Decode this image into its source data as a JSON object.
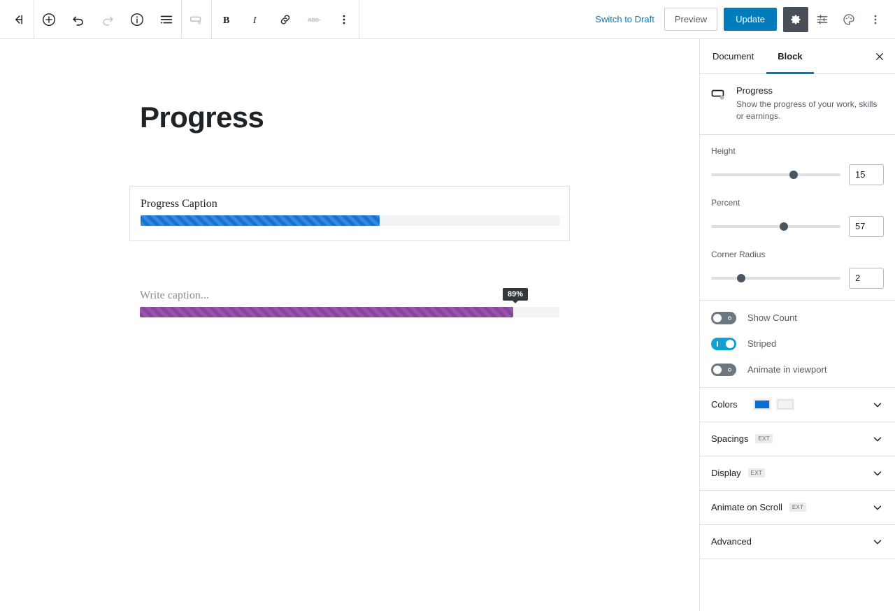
{
  "toolbar": {
    "left_icons": [
      {
        "name": "back-to-dashboard-icon",
        "label": "Back"
      },
      {
        "name": "add-block-icon",
        "label": "Add block"
      },
      {
        "name": "undo-icon",
        "label": "Undo"
      },
      {
        "name": "redo-icon",
        "label": "Redo"
      },
      {
        "name": "info-icon",
        "label": "Details"
      },
      {
        "name": "list-view-icon",
        "label": "List view"
      }
    ],
    "block_type_icon": "progress-block-icon",
    "format_icons": [
      {
        "name": "bold-icon",
        "label": "B"
      },
      {
        "name": "italic-icon",
        "label": "I"
      },
      {
        "name": "link-icon",
        "label": "Link"
      },
      {
        "name": "strikethrough-icon",
        "label": "ABC"
      },
      {
        "name": "more-options-icon",
        "label": "More"
      }
    ],
    "switch_to_draft": "Switch to Draft",
    "preview": "Preview",
    "update": "Update",
    "right_icons": [
      {
        "name": "settings-gear-icon",
        "active": true
      },
      {
        "name": "block-tools-icon",
        "active": false
      },
      {
        "name": "color-palette-icon",
        "active": false
      },
      {
        "name": "kebab-menu-icon",
        "active": false
      }
    ]
  },
  "editor": {
    "post_title": "Progress",
    "blocks": [
      {
        "caption": "Progress Caption",
        "caption_is_placeholder": false,
        "percent": 57,
        "color": "#1673d4",
        "striped": true,
        "show_count": false,
        "selected": true
      },
      {
        "caption": "Write caption...",
        "caption_is_placeholder": true,
        "percent": 89,
        "count_label": "89%",
        "color": "#9b51b0",
        "striped": true,
        "show_count": true,
        "selected": false
      }
    ]
  },
  "sidebar": {
    "tabs": [
      {
        "label": "Document",
        "active": false
      },
      {
        "label": "Block",
        "active": true
      }
    ],
    "close_label": "Close settings",
    "block_card": {
      "icon": "progress-block-icon",
      "title": "Progress",
      "description": "Show the progress of your work, skills or earnings."
    },
    "controls": [
      {
        "label": "Height",
        "value": "15",
        "slider_percent": 64
      },
      {
        "label": "Percent",
        "value": "57",
        "slider_percent": 56
      },
      {
        "label": "Corner Radius",
        "value": "2",
        "slider_percent": 23
      }
    ],
    "toggles": [
      {
        "label": "Show Count",
        "on": false
      },
      {
        "label": "Striped",
        "on": true
      },
      {
        "label": "Animate in viewport",
        "on": false
      }
    ],
    "panels": [
      {
        "title": "Colors",
        "badge": "",
        "swatches": [
          "#0a6ed6",
          "#f1f3f4"
        ]
      },
      {
        "title": "Spacings",
        "badge": "EXT",
        "swatches": []
      },
      {
        "title": "Display",
        "badge": "EXT",
        "swatches": []
      },
      {
        "title": "Animate on Scroll",
        "badge": "EXT",
        "swatches": []
      },
      {
        "title": "Advanced",
        "badge": "",
        "swatches": []
      }
    ]
  },
  "colors": {
    "accent": "#007cba",
    "toggle_on": "#11a0d2",
    "tooltip_bg": "#32373c"
  }
}
